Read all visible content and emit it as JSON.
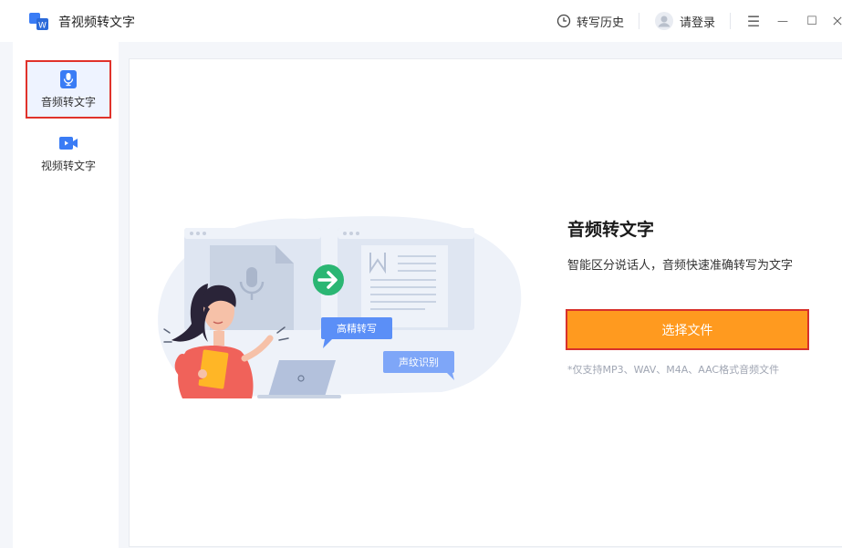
{
  "app": {
    "title": "音视频转文字"
  },
  "titlebar": {
    "history_label": "转写历史",
    "login_label": "请登录",
    "menu_glyph": "☰",
    "minimize_glyph": "—",
    "maximize_glyph": "☐"
  },
  "sidebar": {
    "items": [
      {
        "label": "音频转文字",
        "icon": "microphone-icon",
        "active": true
      },
      {
        "label": "视频转文字",
        "icon": "video-camera-icon",
        "active": false
      }
    ]
  },
  "main": {
    "feature_title": "音频转文字",
    "feature_desc": "智能区分说话人，音频快速准确转写为文字",
    "select_button": "选择文件",
    "support_note": "*仅支持MP3、WAV、M4A、AAC格式音频文件"
  },
  "illustration": {
    "bubble_high_precision": "高精转写",
    "bubble_voiceprint": "声纹识别"
  },
  "colors": {
    "accent": "#ff9a1f",
    "brand_blue": "#3a7cf5",
    "highlight_border": "#e0322b",
    "arrow_green": "#2bb673"
  }
}
